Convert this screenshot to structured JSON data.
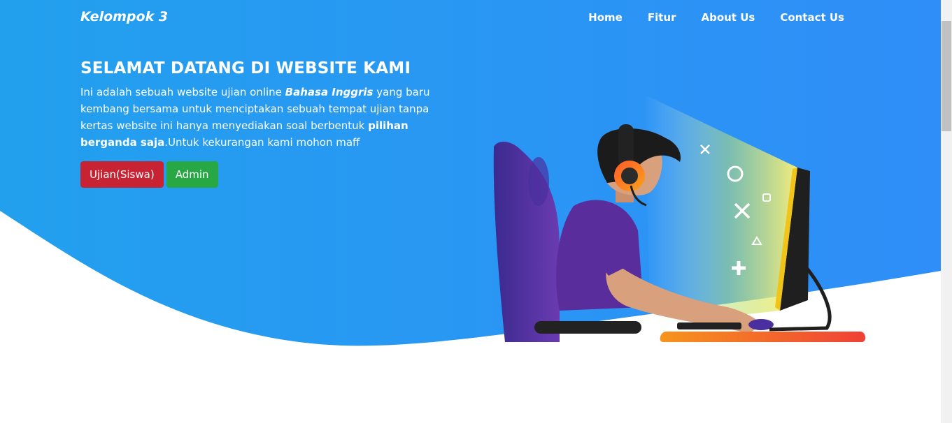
{
  "navbar": {
    "brand": "Kelompok 3",
    "links": [
      "Home",
      "Fitur",
      "About Us",
      "Contact Us"
    ]
  },
  "hero": {
    "title": "SELAMAT DATANG DI WEBSITE KAMI",
    "text_1": "Ini adalah sebuah website ujian online ",
    "text_em": "Bahasa Inggris",
    "text_2": " yang baru kembang bersama untuk menciptakan sebuah tempat ujian tanpa kertas website ini hanya menyediakan soal berbentuk ",
    "text_bold": "pilihan berganda saja",
    "text_3": ".Untuk kekurangan kami mohon maff",
    "buttons": {
      "student": "Ujian(Siswa)",
      "admin": "Admin"
    }
  },
  "colors": {
    "hero_gradient_start": "#22a0ee",
    "hero_gradient_end": "#2f8ef8",
    "student_button": "#c82333",
    "admin_button": "#28a745"
  }
}
